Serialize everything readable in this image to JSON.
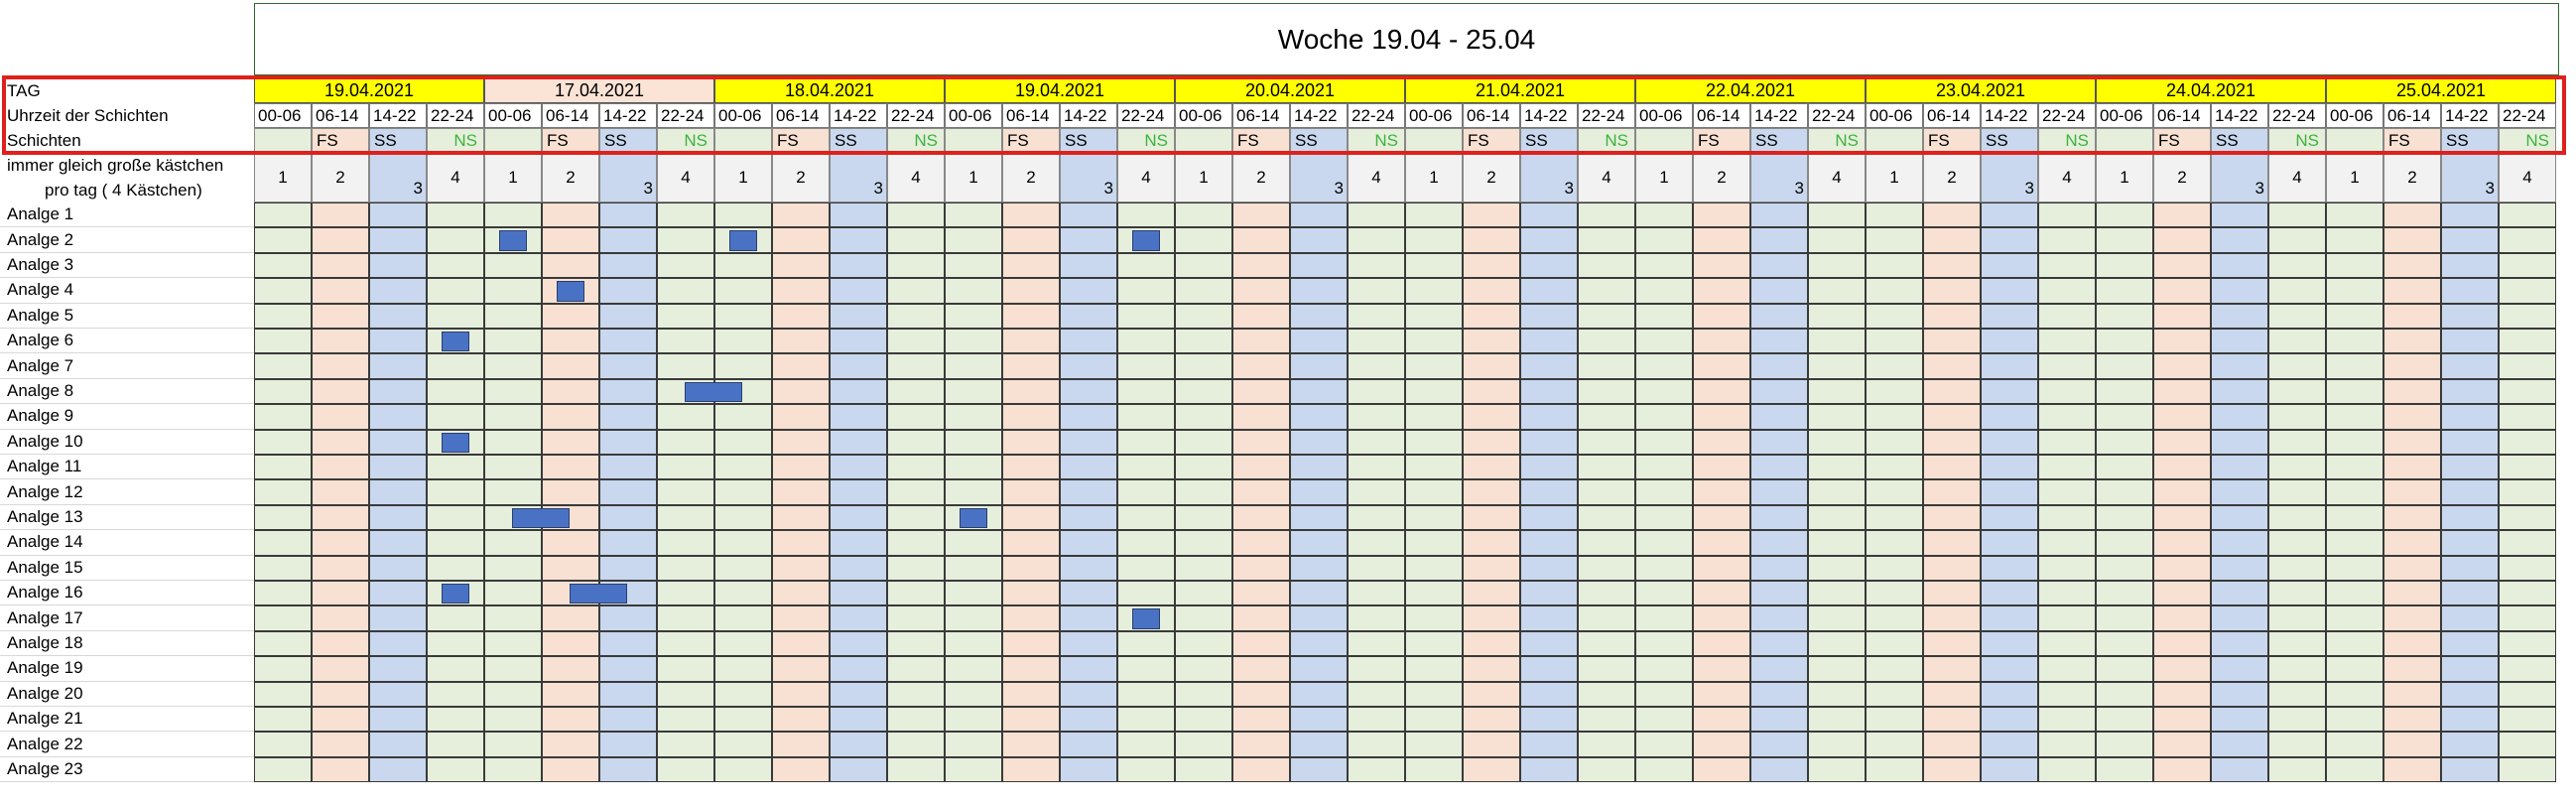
{
  "title": "Woche 19.04 - 25.04",
  "labels": {
    "tag": "TAG",
    "uhrzeit": "Uhrzeit der Schichten",
    "schichten": "Schichten",
    "note_line1": "immer gleich große kästchen",
    "note_line2": "pro tag ( 4 Kästchen)"
  },
  "days": [
    {
      "date": "19.04.2021",
      "highlight": "yellow"
    },
    {
      "date": "17.04.2021",
      "highlight": "peach"
    },
    {
      "date": "18.04.2021",
      "highlight": "yellow"
    },
    {
      "date": "19.04.2021",
      "highlight": "yellow"
    },
    {
      "date": "20.04.2021",
      "highlight": "yellow"
    },
    {
      "date": "21.04.2021",
      "highlight": "yellow"
    },
    {
      "date": "22.04.2021",
      "highlight": "yellow"
    },
    {
      "date": "23.04.2021",
      "highlight": "yellow"
    },
    {
      "date": "24.04.2021",
      "highlight": "yellow"
    },
    {
      "date": "25.04.2021",
      "highlight": "yellow"
    }
  ],
  "slots": [
    {
      "time": "00-06",
      "shift": "",
      "number": "1"
    },
    {
      "time": "06-14",
      "shift": "FS",
      "number": "2"
    },
    {
      "time": "14-22",
      "shift": "SS",
      "number": "3"
    },
    {
      "time": "22-24",
      "shift": "NS",
      "number": "4"
    }
  ],
  "rows": [
    "Analge 1",
    "Analge 2",
    "Analge 3",
    "Analge 4",
    "Analge 5",
    "Analge 6",
    "Analge 7",
    "Analge 8",
    "Analge 9",
    "Analge 10",
    "Analge 11",
    "Analge 12",
    "Analge 13",
    "Analge 14",
    "Analge 15",
    "Analge 16",
    "Analge 17",
    "Analge 18",
    "Analge 19",
    "Analge 20",
    "Analge 21",
    "Analge 22",
    "Analge 23"
  ],
  "blocks": [
    {
      "row": 1,
      "day": 1,
      "slot": 0
    },
    {
      "row": 1,
      "day": 2,
      "slot": 0
    },
    {
      "row": 1,
      "day": 3,
      "slot": 3
    },
    {
      "row": 3,
      "day": 1,
      "slot": 1
    },
    {
      "row": 5,
      "day": 0,
      "slot": 3
    },
    {
      "row": 7,
      "day": 1,
      "slot": 3,
      "span": 2
    },
    {
      "row": 9,
      "day": 0,
      "slot": 3
    },
    {
      "row": 12,
      "day": 1,
      "slot": 0,
      "span": 2
    },
    {
      "row": 12,
      "day": 3,
      "slot": 0
    },
    {
      "row": 15,
      "day": 0,
      "slot": 3
    },
    {
      "row": 15,
      "day": 1,
      "slot": 1,
      "span": 2
    },
    {
      "row": 16,
      "day": 3,
      "slot": 3
    }
  ],
  "colors": {
    "slot_fill": [
      "#e6efdc",
      "#f8e1d2",
      "#c9d8ee",
      "#e6efdc"
    ],
    "date_yellow": "#ffff00",
    "date_peach": "#fbe3d6",
    "header_fill": "#f2f2f2",
    "block": "#4a72c4",
    "ns_text": "#3cb43c",
    "highlight_border": "#e0201c",
    "title_border": "#2f6b2f"
  }
}
